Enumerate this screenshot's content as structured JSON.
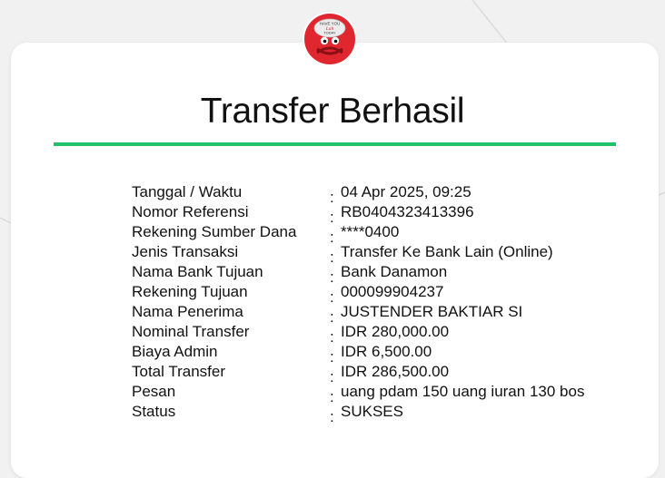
{
  "header": {
    "title": "Transfer Berhasil",
    "mascot_caption_top": "HAVE YOU",
    "mascot_caption_mid": "Lah",
    "mascot_caption_bottom": "TODAY"
  },
  "colors": {
    "accent_green": "#1fc16b",
    "mascot_red": "#e0262f"
  },
  "separator": ":",
  "details": [
    {
      "label": "Tanggal / Waktu",
      "value": "04 Apr 2025, 09:25"
    },
    {
      "label": "Nomor Referensi",
      "value": "RB0404323413396"
    },
    {
      "label": "Rekening Sumber Dana",
      "value": "****0400"
    },
    {
      "label": "Jenis Transaksi",
      "value": "Transfer Ke Bank Lain (Online)"
    },
    {
      "label": "Nama Bank Tujuan",
      "value": "Bank Danamon"
    },
    {
      "label": "Rekening Tujuan",
      "value": "000099904237"
    },
    {
      "label": "Nama Penerima",
      "value": "JUSTENDER BAKTIAR SI"
    },
    {
      "label": "Nominal Transfer",
      "value": "IDR 280,000.00"
    },
    {
      "label": "Biaya Admin",
      "value": "IDR 6,500.00"
    },
    {
      "label": "Total Transfer",
      "value": "IDR 286,500.00"
    },
    {
      "label": "Pesan",
      "value": "uang pdam 150 uang iuran 130 bos"
    },
    {
      "label": "Status",
      "value": "SUKSES"
    }
  ]
}
